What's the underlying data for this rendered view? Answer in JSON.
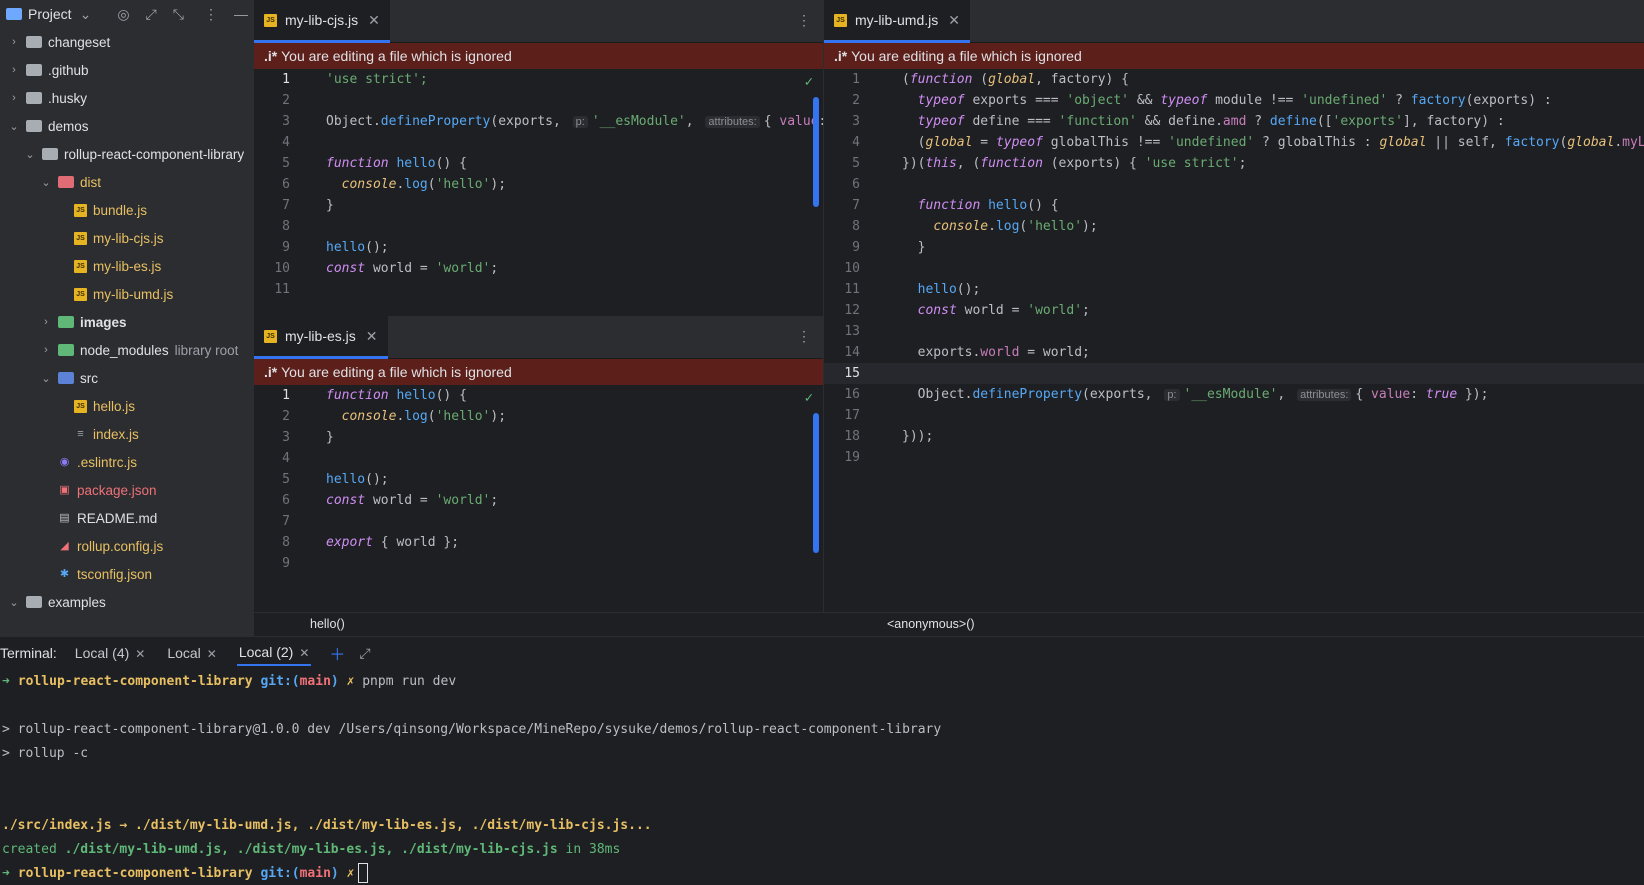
{
  "sidebar": {
    "title": "Project",
    "tree": [
      {
        "label": "changeset",
        "kind": "folder",
        "depth": 0,
        "arrow": "›"
      },
      {
        "label": ".github",
        "kind": "folder",
        "depth": 0,
        "arrow": "›"
      },
      {
        "label": ".husky",
        "kind": "folder",
        "depth": 0,
        "arrow": "›"
      },
      {
        "label": "demos",
        "kind": "folder",
        "depth": 0,
        "arrow": "⌄"
      },
      {
        "label": "rollup-react-component-library",
        "kind": "folder",
        "depth": 1,
        "arrow": "⌄"
      },
      {
        "label": "dist",
        "kind": "folder-red",
        "depth": 2,
        "arrow": "⌄",
        "color": "yellow"
      },
      {
        "label": "bundle.js",
        "kind": "js",
        "depth": 3,
        "color": "yellow"
      },
      {
        "label": "my-lib-cjs.js",
        "kind": "js",
        "depth": 3,
        "color": "yellow"
      },
      {
        "label": "my-lib-es.js",
        "kind": "js",
        "depth": 3,
        "color": "yellow"
      },
      {
        "label": "my-lib-umd.js",
        "kind": "js",
        "depth": 3,
        "color": "yellow"
      },
      {
        "label": "images",
        "kind": "folder-green",
        "depth": 2,
        "arrow": "›",
        "color": "bold"
      },
      {
        "label": "node_modules",
        "kind": "folder-green",
        "depth": 2,
        "arrow": "›",
        "suffix": "library root"
      },
      {
        "label": "src",
        "kind": "folder-blue",
        "depth": 2,
        "arrow": "⌄"
      },
      {
        "label": "hello.js",
        "kind": "js",
        "depth": 3,
        "color": "yellow"
      },
      {
        "label": "index.js",
        "kind": "list",
        "depth": 3,
        "color": "yellow"
      },
      {
        "label": ".eslintrc.js",
        "kind": "eslint",
        "depth": 2,
        "color": "yellow"
      },
      {
        "label": "package.json",
        "kind": "pkg",
        "depth": 2,
        "color": "red"
      },
      {
        "label": "README.md",
        "kind": "md",
        "depth": 2
      },
      {
        "label": "rollup.config.js",
        "kind": "rollup",
        "depth": 2,
        "color": "yellow"
      },
      {
        "label": "tsconfig.json",
        "kind": "ts",
        "depth": 2,
        "color": "yellow"
      },
      {
        "label": "examples",
        "kind": "folder",
        "depth": 0,
        "arrow": "⌄"
      }
    ]
  },
  "banner_text": "You are editing a file which is ignored",
  "banner_prefix": ".i*",
  "editors": {
    "cjs": {
      "tab": "my-lib-cjs.js",
      "breadcrumb": "hello()",
      "current_line": 1,
      "lines": [
        [
          {
            "t": "'use strict';",
            "c": "str"
          }
        ],
        [],
        [
          {
            "t": "Object."
          },
          {
            "t": "defineProperty",
            "c": "fn"
          },
          {
            "t": "(exports, "
          },
          {
            "t": "p:",
            "c": "hint"
          },
          {
            "t": "'__esModule'",
            "c": "str"
          },
          {
            "t": ", "
          },
          {
            "t": "attributes:",
            "c": "hint"
          },
          {
            "t": "{ "
          },
          {
            "t": "value",
            "c": "prop"
          },
          {
            "t": ": "
          },
          {
            "t": "true",
            "c": "tail"
          }
        ],
        [],
        [
          {
            "t": "function ",
            "c": "kw"
          },
          {
            "t": "hello",
            "c": "fn"
          },
          {
            "t": "() {"
          }
        ],
        [
          {
            "t": "  "
          },
          {
            "t": "console",
            "c": "param"
          },
          {
            "t": "."
          },
          {
            "t": "log",
            "c": "fn"
          },
          {
            "t": "("
          },
          {
            "t": "'hello'",
            "c": "str"
          },
          {
            "t": ");"
          }
        ],
        [
          {
            "t": "}"
          }
        ],
        [],
        [
          {
            "t": "hello",
            "c": "fn"
          },
          {
            "t": "();"
          }
        ],
        [
          {
            "t": "const ",
            "c": "kw"
          },
          {
            "t": "world = "
          },
          {
            "t": "'world'",
            "c": "str"
          },
          {
            "t": ";"
          }
        ],
        []
      ]
    },
    "es": {
      "tab": "my-lib-es.js",
      "breadcrumb": "",
      "current_line": 1,
      "lines": [
        [
          {
            "t": "function ",
            "c": "kw"
          },
          {
            "t": "hello",
            "c": "fn"
          },
          {
            "t": "() {"
          }
        ],
        [
          {
            "t": "  "
          },
          {
            "t": "console",
            "c": "param"
          },
          {
            "t": "."
          },
          {
            "t": "log",
            "c": "fn"
          },
          {
            "t": "("
          },
          {
            "t": "'hello'",
            "c": "str"
          },
          {
            "t": ");"
          }
        ],
        [
          {
            "t": "}"
          }
        ],
        [],
        [
          {
            "t": "hello",
            "c": "fn"
          },
          {
            "t": "();"
          }
        ],
        [
          {
            "t": "const ",
            "c": "kw"
          },
          {
            "t": "world = "
          },
          {
            "t": "'world'",
            "c": "str"
          },
          {
            "t": ";"
          }
        ],
        [],
        [
          {
            "t": "export ",
            "c": "kw"
          },
          {
            "t": "{ world };"
          }
        ],
        []
      ]
    },
    "umd": {
      "tab": "my-lib-umd.js",
      "breadcrumb": "<anonymous>()",
      "current_line": 15,
      "lines": [
        [
          {
            "t": "("
          },
          {
            "t": "function ",
            "c": "kw"
          },
          {
            "t": "("
          },
          {
            "t": "global",
            "c": "param"
          },
          {
            "t": ", factory) {"
          }
        ],
        [
          {
            "t": "  "
          },
          {
            "t": "typeof ",
            "c": "kw"
          },
          {
            "t": "exports === "
          },
          {
            "t": "'object'",
            "c": "str"
          },
          {
            "t": " && "
          },
          {
            "t": "typeof ",
            "c": "kw"
          },
          {
            "t": "module !== "
          },
          {
            "t": "'undefined'",
            "c": "str"
          },
          {
            "t": " ? "
          },
          {
            "t": "factory",
            "c": "fn"
          },
          {
            "t": "(exports) :"
          }
        ],
        [
          {
            "t": "  "
          },
          {
            "t": "typeof ",
            "c": "kw"
          },
          {
            "t": "define === "
          },
          {
            "t": "'function'",
            "c": "str"
          },
          {
            "t": " && define."
          },
          {
            "t": "amd",
            "c": "prop"
          },
          {
            "t": " ? "
          },
          {
            "t": "define",
            "c": "fn"
          },
          {
            "t": "(["
          },
          {
            "t": "'exports'",
            "c": "str"
          },
          {
            "t": "], factory) :"
          }
        ],
        [
          {
            "t": "  ("
          },
          {
            "t": "global",
            "c": "param"
          },
          {
            "t": " = "
          },
          {
            "t": "typeof ",
            "c": "kw"
          },
          {
            "t": "globalThis !== "
          },
          {
            "t": "'undefined'",
            "c": "str"
          },
          {
            "t": " ? globalThis : "
          },
          {
            "t": "global",
            "c": "param"
          },
          {
            "t": " || self, "
          },
          {
            "t": "factory",
            "c": "fn"
          },
          {
            "t": "("
          },
          {
            "t": "global",
            "c": "param"
          },
          {
            "t": "."
          },
          {
            "t": "myLib",
            "c": "prop"
          },
          {
            "t": " = {}));"
          }
        ],
        [
          {
            "t": "})("
          },
          {
            "t": "this",
            "c": "kw"
          },
          {
            "t": ", ("
          },
          {
            "t": "function ",
            "c": "kw"
          },
          {
            "t": "(exports) { "
          },
          {
            "t": "'use strict'",
            "c": "str"
          },
          {
            "t": ";"
          }
        ],
        [],
        [
          {
            "t": "  "
          },
          {
            "t": "function ",
            "c": "kw"
          },
          {
            "t": "hello",
            "c": "fn"
          },
          {
            "t": "() {"
          }
        ],
        [
          {
            "t": "    "
          },
          {
            "t": "console",
            "c": "param"
          },
          {
            "t": "."
          },
          {
            "t": "log",
            "c": "fn"
          },
          {
            "t": "("
          },
          {
            "t": "'hello'",
            "c": "str"
          },
          {
            "t": ");"
          }
        ],
        [
          {
            "t": "  }"
          }
        ],
        [],
        [
          {
            "t": "  "
          },
          {
            "t": "hello",
            "c": "fn"
          },
          {
            "t": "();"
          }
        ],
        [
          {
            "t": "  "
          },
          {
            "t": "const ",
            "c": "kw"
          },
          {
            "t": "world = "
          },
          {
            "t": "'world'",
            "c": "str"
          },
          {
            "t": ";"
          }
        ],
        [],
        [
          {
            "t": "  exports."
          },
          {
            "t": "world",
            "c": "prop"
          },
          {
            "t": " = world;"
          }
        ],
        [],
        [
          {
            "t": "  Object."
          },
          {
            "t": "defineProperty",
            "c": "fn"
          },
          {
            "t": "(exports, "
          },
          {
            "t": "p:",
            "c": "hint"
          },
          {
            "t": "'__esModule'",
            "c": "str"
          },
          {
            "t": ", "
          },
          {
            "t": "attributes:",
            "c": "hint"
          },
          {
            "t": "{ "
          },
          {
            "t": "value",
            "c": "prop"
          },
          {
            "t": ": "
          },
          {
            "t": "true",
            "c": "tail"
          },
          {
            "t": " });"
          }
        ],
        [],
        [
          {
            "t": "}));"
          }
        ],
        []
      ]
    }
  },
  "terminal": {
    "label": "Terminal:",
    "tabs": [
      "Local (4)",
      "Local",
      "Local (2)"
    ],
    "active_tab": 2,
    "prompt_dir": "rollup-react-component-library",
    "prompt_git": "git:(",
    "prompt_branch": "main",
    "prompt_git_close": ")",
    "prompt_x": "✗",
    "command": "pnpm run dev",
    "out1": "> rollup-react-component-library@1.0.0 dev /Users/qinsong/Workspace/MineRepo/sysuke/demos/rollup-react-component-library",
    "out2": "> rollup -c",
    "build_line": "./src/index.js → ./dist/my-lib-umd.js, ./dist/my-lib-es.js, ./dist/my-lib-cjs.js...",
    "created_prefix": "created ",
    "created_files": "./dist/my-lib-umd.js, ./dist/my-lib-es.js, ./dist/my-lib-cjs.js",
    "created_time": " in 38ms"
  },
  "colors": {
    "accent": "#3574f0",
    "banner_bg": "#5c1f1a"
  }
}
